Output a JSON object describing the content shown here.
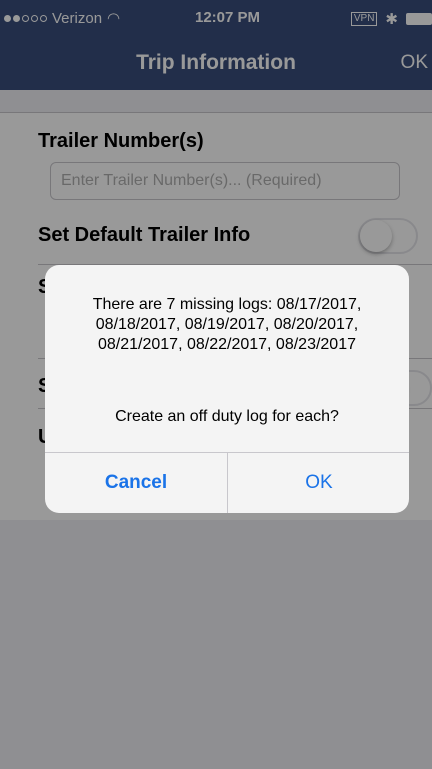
{
  "status_bar": {
    "carrier": "Verizon",
    "time": "12:07 PM",
    "vpn": "VPN"
  },
  "nav": {
    "title": "Trip Information",
    "ok_label": "OK"
  },
  "form": {
    "trailer_label": "Trailer Number(s)",
    "trailer_placeholder": "Enter Trailer Number(s)... (Required)",
    "default_trailer_label": "Set Default Trailer Info"
  },
  "alert": {
    "message": "There are 7 missing logs: 08/17/2017, 08/18/2017, 08/19/2017, 08/20/2017, 08/21/2017, 08/22/2017, 08/23/2017",
    "question": "Create an off duty log for each?",
    "cancel_label": "Cancel",
    "ok_label": "OK"
  }
}
